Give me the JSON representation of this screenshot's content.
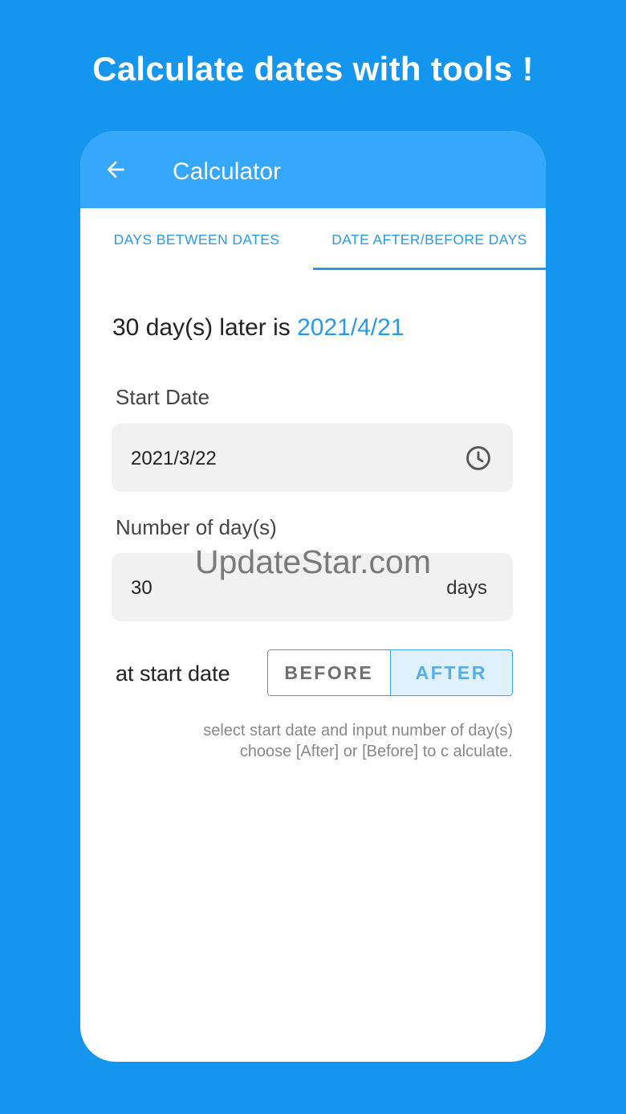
{
  "headline": "Calculate dates with tools !",
  "appbar": {
    "title": "Calculator"
  },
  "tabs": [
    {
      "label": "DAYS BETWEEN DATES",
      "selected": false
    },
    {
      "label": "DATE AFTER/BEFORE DAYS",
      "selected": true
    }
  ],
  "result": {
    "prefix": "30 day(s) later is ",
    "date": "2021/4/21"
  },
  "start_date": {
    "label": "Start Date",
    "value": "2021/3/22"
  },
  "days": {
    "label": "Number of day(s)",
    "value": "30",
    "suffix": "days"
  },
  "direction": {
    "label": "at start date",
    "before": "BEFORE",
    "after": "AFTER",
    "selected": "AFTER"
  },
  "hint": {
    "line1": "select start date and input number of day(s)",
    "line2": "choose [After] or [Before] to c alculate."
  },
  "watermark": "UpdateStar.com",
  "colors": {
    "background": "#1496ee",
    "appbar": "#35a8fb",
    "accent": "#2a9ae6",
    "field": "#f1f1f1"
  }
}
